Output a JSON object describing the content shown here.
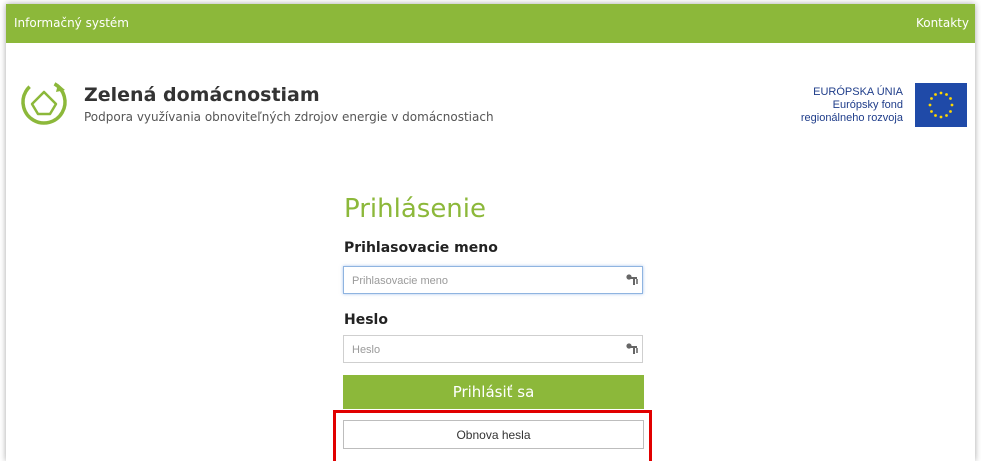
{
  "topbar": {
    "system_label": "Informačný systém",
    "contacts_label": "Kontakty"
  },
  "brand": {
    "title": "Zelená domácnostiam",
    "subtitle": "Podpora využívania obnoviteľných zdrojov energie v domácnostiach"
  },
  "eu": {
    "line1": "EURÓPSKA ÚNIA",
    "line2": "Európsky fond",
    "line3": "regionálneho rozvoja"
  },
  "login": {
    "title": "Prihlásenie",
    "username_label": "Prihlasovacie meno",
    "username_placeholder": "Prihlasovacie meno",
    "password_label": "Heslo",
    "password_placeholder": "Heslo",
    "submit_label": "Prihlásiť sa",
    "reset_label": "Obnova hesla"
  },
  "colors": {
    "accent": "#8cb83a",
    "eu_blue": "#1f4aa8",
    "highlight": "#e10000"
  }
}
